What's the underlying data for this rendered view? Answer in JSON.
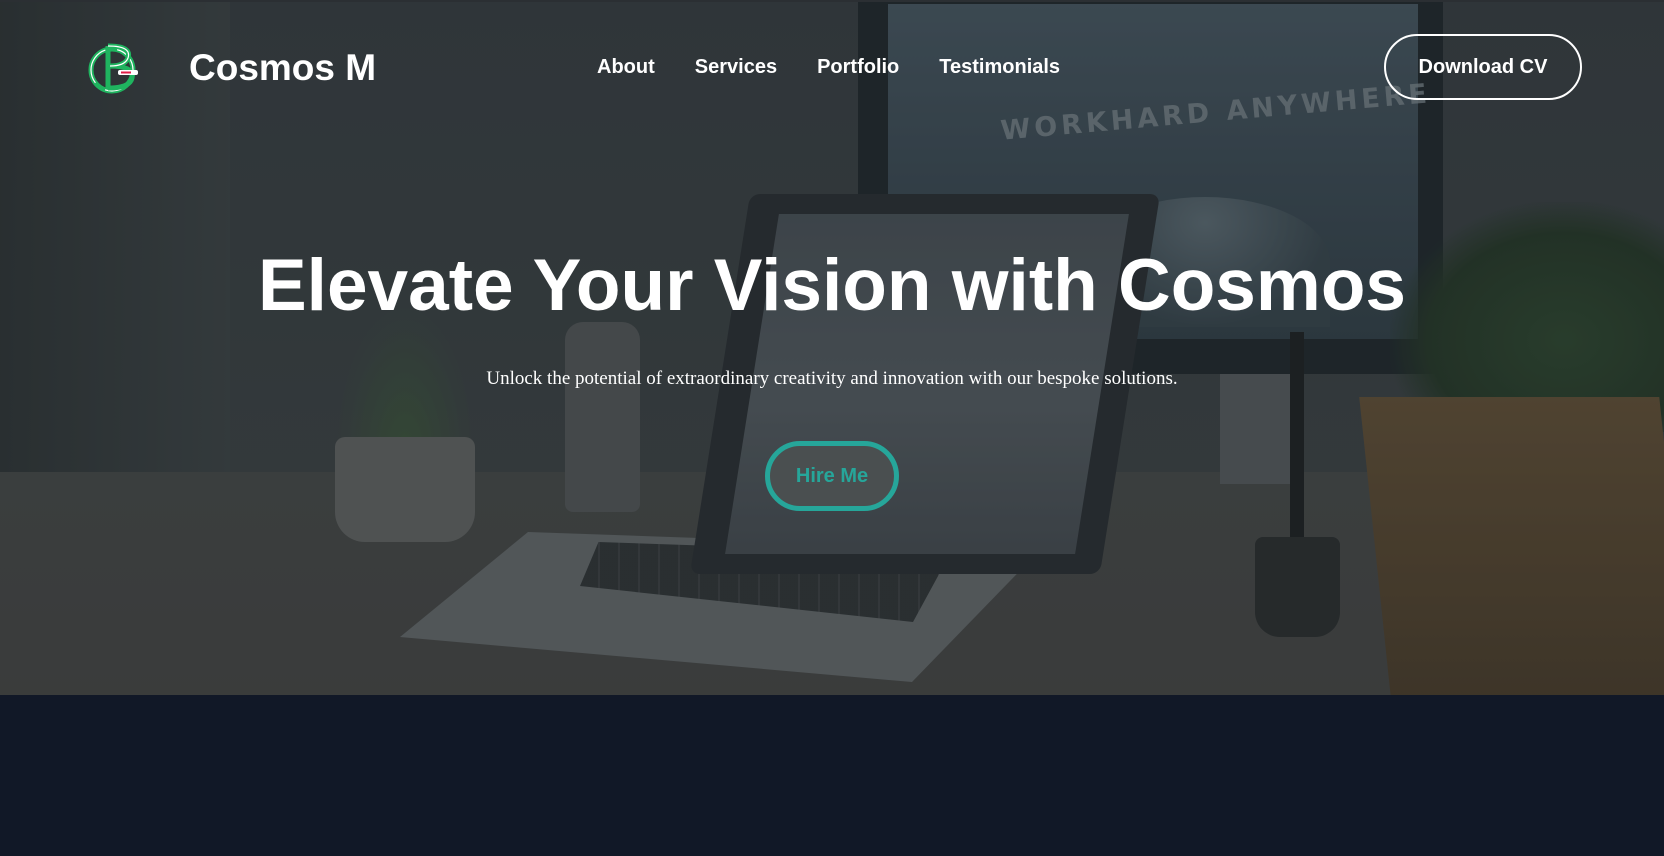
{
  "navbar": {
    "logo_icon": "cb-monogram-logo",
    "brand": "Cosmos M",
    "links": [
      "About",
      "Services",
      "Portfolio",
      "Testimonials"
    ],
    "cta_label": "Download CV"
  },
  "hero": {
    "title": "Elevate Your Vision with Cosmos",
    "subtitle": "Unlock the potential of extraordinary creativity and innovation with our bespoke solutions.",
    "button_label": "Hire Me",
    "background_text": "WORKHARD ANYWHERE"
  },
  "colors": {
    "accent": "#26a69a",
    "logo_green": "#1fb45f",
    "page_background": "#111827"
  }
}
